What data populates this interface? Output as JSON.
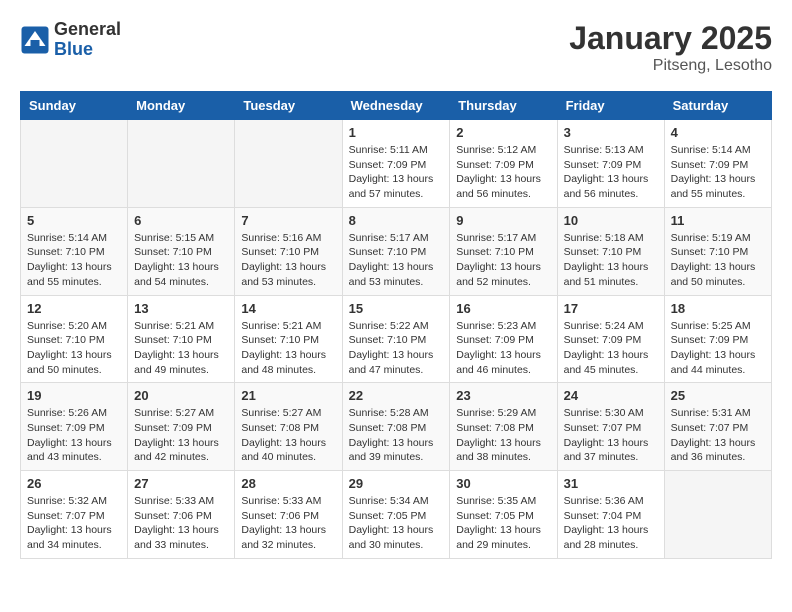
{
  "logo": {
    "general": "General",
    "blue": "Blue"
  },
  "header": {
    "month": "January 2025",
    "location": "Pitseng, Lesotho"
  },
  "days_of_week": [
    "Sunday",
    "Monday",
    "Tuesday",
    "Wednesday",
    "Thursday",
    "Friday",
    "Saturday"
  ],
  "weeks": [
    [
      {
        "day": "",
        "info": ""
      },
      {
        "day": "",
        "info": ""
      },
      {
        "day": "",
        "info": ""
      },
      {
        "day": "1",
        "info": "Sunrise: 5:11 AM\nSunset: 7:09 PM\nDaylight: 13 hours\nand 57 minutes."
      },
      {
        "day": "2",
        "info": "Sunrise: 5:12 AM\nSunset: 7:09 PM\nDaylight: 13 hours\nand 56 minutes."
      },
      {
        "day": "3",
        "info": "Sunrise: 5:13 AM\nSunset: 7:09 PM\nDaylight: 13 hours\nand 56 minutes."
      },
      {
        "day": "4",
        "info": "Sunrise: 5:14 AM\nSunset: 7:09 PM\nDaylight: 13 hours\nand 55 minutes."
      }
    ],
    [
      {
        "day": "5",
        "info": "Sunrise: 5:14 AM\nSunset: 7:10 PM\nDaylight: 13 hours\nand 55 minutes."
      },
      {
        "day": "6",
        "info": "Sunrise: 5:15 AM\nSunset: 7:10 PM\nDaylight: 13 hours\nand 54 minutes."
      },
      {
        "day": "7",
        "info": "Sunrise: 5:16 AM\nSunset: 7:10 PM\nDaylight: 13 hours\nand 53 minutes."
      },
      {
        "day": "8",
        "info": "Sunrise: 5:17 AM\nSunset: 7:10 PM\nDaylight: 13 hours\nand 53 minutes."
      },
      {
        "day": "9",
        "info": "Sunrise: 5:17 AM\nSunset: 7:10 PM\nDaylight: 13 hours\nand 52 minutes."
      },
      {
        "day": "10",
        "info": "Sunrise: 5:18 AM\nSunset: 7:10 PM\nDaylight: 13 hours\nand 51 minutes."
      },
      {
        "day": "11",
        "info": "Sunrise: 5:19 AM\nSunset: 7:10 PM\nDaylight: 13 hours\nand 50 minutes."
      }
    ],
    [
      {
        "day": "12",
        "info": "Sunrise: 5:20 AM\nSunset: 7:10 PM\nDaylight: 13 hours\nand 50 minutes."
      },
      {
        "day": "13",
        "info": "Sunrise: 5:21 AM\nSunset: 7:10 PM\nDaylight: 13 hours\nand 49 minutes."
      },
      {
        "day": "14",
        "info": "Sunrise: 5:21 AM\nSunset: 7:10 PM\nDaylight: 13 hours\nand 48 minutes."
      },
      {
        "day": "15",
        "info": "Sunrise: 5:22 AM\nSunset: 7:10 PM\nDaylight: 13 hours\nand 47 minutes."
      },
      {
        "day": "16",
        "info": "Sunrise: 5:23 AM\nSunset: 7:09 PM\nDaylight: 13 hours\nand 46 minutes."
      },
      {
        "day": "17",
        "info": "Sunrise: 5:24 AM\nSunset: 7:09 PM\nDaylight: 13 hours\nand 45 minutes."
      },
      {
        "day": "18",
        "info": "Sunrise: 5:25 AM\nSunset: 7:09 PM\nDaylight: 13 hours\nand 44 minutes."
      }
    ],
    [
      {
        "day": "19",
        "info": "Sunrise: 5:26 AM\nSunset: 7:09 PM\nDaylight: 13 hours\nand 43 minutes."
      },
      {
        "day": "20",
        "info": "Sunrise: 5:27 AM\nSunset: 7:09 PM\nDaylight: 13 hours\nand 42 minutes."
      },
      {
        "day": "21",
        "info": "Sunrise: 5:27 AM\nSunset: 7:08 PM\nDaylight: 13 hours\nand 40 minutes."
      },
      {
        "day": "22",
        "info": "Sunrise: 5:28 AM\nSunset: 7:08 PM\nDaylight: 13 hours\nand 39 minutes."
      },
      {
        "day": "23",
        "info": "Sunrise: 5:29 AM\nSunset: 7:08 PM\nDaylight: 13 hours\nand 38 minutes."
      },
      {
        "day": "24",
        "info": "Sunrise: 5:30 AM\nSunset: 7:07 PM\nDaylight: 13 hours\nand 37 minutes."
      },
      {
        "day": "25",
        "info": "Sunrise: 5:31 AM\nSunset: 7:07 PM\nDaylight: 13 hours\nand 36 minutes."
      }
    ],
    [
      {
        "day": "26",
        "info": "Sunrise: 5:32 AM\nSunset: 7:07 PM\nDaylight: 13 hours\nand 34 minutes."
      },
      {
        "day": "27",
        "info": "Sunrise: 5:33 AM\nSunset: 7:06 PM\nDaylight: 13 hours\nand 33 minutes."
      },
      {
        "day": "28",
        "info": "Sunrise: 5:33 AM\nSunset: 7:06 PM\nDaylight: 13 hours\nand 32 minutes."
      },
      {
        "day": "29",
        "info": "Sunrise: 5:34 AM\nSunset: 7:05 PM\nDaylight: 13 hours\nand 30 minutes."
      },
      {
        "day": "30",
        "info": "Sunrise: 5:35 AM\nSunset: 7:05 PM\nDaylight: 13 hours\nand 29 minutes."
      },
      {
        "day": "31",
        "info": "Sunrise: 5:36 AM\nSunset: 7:04 PM\nDaylight: 13 hours\nand 28 minutes."
      },
      {
        "day": "",
        "info": ""
      }
    ]
  ]
}
